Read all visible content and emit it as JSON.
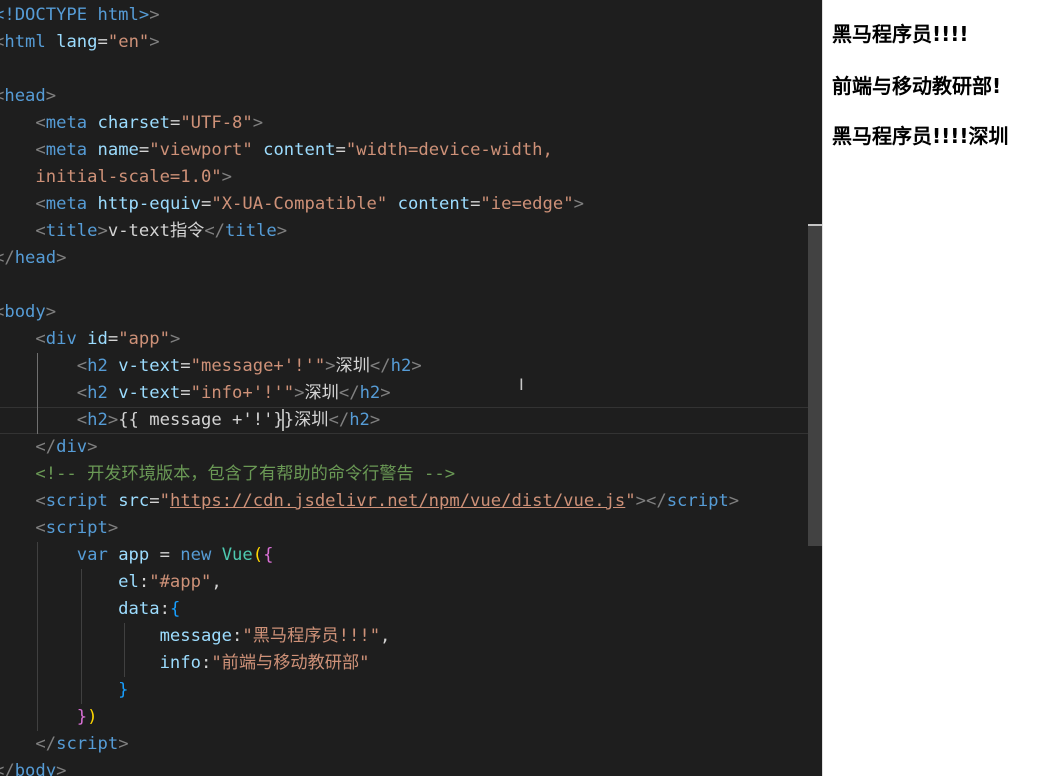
{
  "editor": {
    "lines": [
      [
        {
          "t": "<!DOCTYPE html>",
          "c": "#569cd6"
        },
        {
          "t": ">",
          "c": "#808080"
        }
      ],
      [
        {
          "t": "<",
          "c": "#808080"
        },
        {
          "t": "html",
          "c": "#569cd6"
        },
        {
          "t": " lang",
          "c": "#9cdcfe"
        },
        {
          "t": "=",
          "c": "#d4d4d4"
        },
        {
          "t": "\"en\"",
          "c": "#ce9178"
        },
        {
          "t": ">",
          "c": "#808080"
        }
      ],
      [],
      [
        {
          "t": "<",
          "c": "#808080"
        },
        {
          "t": "head",
          "c": "#569cd6"
        },
        {
          "t": ">",
          "c": "#808080"
        }
      ],
      [
        {
          "t": "    <",
          "c": "#808080"
        },
        {
          "t": "meta",
          "c": "#569cd6"
        },
        {
          "t": " charset",
          "c": "#9cdcfe"
        },
        {
          "t": "=",
          "c": "#d4d4d4"
        },
        {
          "t": "\"UTF-8\"",
          "c": "#ce9178"
        },
        {
          "t": ">",
          "c": "#808080"
        }
      ],
      [
        {
          "t": "    <",
          "c": "#808080"
        },
        {
          "t": "meta",
          "c": "#569cd6"
        },
        {
          "t": " name",
          "c": "#9cdcfe"
        },
        {
          "t": "=",
          "c": "#d4d4d4"
        },
        {
          "t": "\"viewport\"",
          "c": "#ce9178"
        },
        {
          "t": " content",
          "c": "#9cdcfe"
        },
        {
          "t": "=",
          "c": "#d4d4d4"
        },
        {
          "t": "\"width=device-width,",
          "c": "#ce9178"
        }
      ],
      [
        {
          "t": "    initial-scale=1.0\"",
          "c": "#ce9178"
        },
        {
          "t": ">",
          "c": "#808080"
        }
      ],
      [
        {
          "t": "    <",
          "c": "#808080"
        },
        {
          "t": "meta",
          "c": "#569cd6"
        },
        {
          "t": " http-equiv",
          "c": "#9cdcfe"
        },
        {
          "t": "=",
          "c": "#d4d4d4"
        },
        {
          "t": "\"X-UA-Compatible\"",
          "c": "#ce9178"
        },
        {
          "t": " content",
          "c": "#9cdcfe"
        },
        {
          "t": "=",
          "c": "#d4d4d4"
        },
        {
          "t": "\"ie=edge\"",
          "c": "#ce9178"
        },
        {
          "t": ">",
          "c": "#808080"
        }
      ],
      [
        {
          "t": "    <",
          "c": "#808080"
        },
        {
          "t": "title",
          "c": "#569cd6"
        },
        {
          "t": ">",
          "c": "#808080"
        },
        {
          "t": "v-text指令",
          "c": "#d4d4d4"
        },
        {
          "t": "</",
          "c": "#808080"
        },
        {
          "t": "title",
          "c": "#569cd6"
        },
        {
          "t": ">",
          "c": "#808080"
        }
      ],
      [
        {
          "t": "</",
          "c": "#808080"
        },
        {
          "t": "head",
          "c": "#569cd6"
        },
        {
          "t": ">",
          "c": "#808080"
        }
      ],
      [],
      [
        {
          "t": "<",
          "c": "#808080"
        },
        {
          "t": "body",
          "c": "#569cd6"
        },
        {
          "t": ">",
          "c": "#808080"
        }
      ],
      [
        {
          "t": "    <",
          "c": "#808080"
        },
        {
          "t": "div",
          "c": "#569cd6"
        },
        {
          "t": " id",
          "c": "#9cdcfe"
        },
        {
          "t": "=",
          "c": "#d4d4d4"
        },
        {
          "t": "\"app\"",
          "c": "#ce9178"
        },
        {
          "t": ">",
          "c": "#808080"
        }
      ],
      [
        {
          "t": "        <",
          "c": "#808080"
        },
        {
          "t": "h2",
          "c": "#569cd6"
        },
        {
          "t": " v-text",
          "c": "#9cdcfe"
        },
        {
          "t": "=",
          "c": "#d4d4d4"
        },
        {
          "t": "\"message+'!'\"",
          "c": "#ce9178"
        },
        {
          "t": ">",
          "c": "#808080"
        },
        {
          "t": "深圳",
          "c": "#d4d4d4"
        },
        {
          "t": "</",
          "c": "#808080"
        },
        {
          "t": "h2",
          "c": "#569cd6"
        },
        {
          "t": ">",
          "c": "#808080"
        }
      ],
      [
        {
          "t": "        <",
          "c": "#808080"
        },
        {
          "t": "h2",
          "c": "#569cd6"
        },
        {
          "t": " v-text",
          "c": "#9cdcfe"
        },
        {
          "t": "=",
          "c": "#d4d4d4"
        },
        {
          "t": "\"info+'!'\"",
          "c": "#ce9178"
        },
        {
          "t": ">",
          "c": "#808080"
        },
        {
          "t": "深圳",
          "c": "#d4d4d4"
        },
        {
          "t": "</",
          "c": "#808080"
        },
        {
          "t": "h2",
          "c": "#569cd6"
        },
        {
          "t": ">",
          "c": "#808080"
        }
      ],
      [
        {
          "t": "        <",
          "c": "#808080"
        },
        {
          "t": "h2",
          "c": "#569cd6"
        },
        {
          "t": ">",
          "c": "#808080"
        },
        {
          "t": "{{ message +'!'}}深圳",
          "c": "#d4d4d4"
        },
        {
          "t": "</",
          "c": "#808080"
        },
        {
          "t": "h2",
          "c": "#569cd6"
        },
        {
          "t": ">",
          "c": "#808080"
        }
      ],
      [
        {
          "t": "    </",
          "c": "#808080"
        },
        {
          "t": "div",
          "c": "#569cd6"
        },
        {
          "t": ">",
          "c": "#808080"
        }
      ],
      [
        {
          "t": "    <!-- 开发环境版本，包含了有帮助的命令行警告 -->",
          "c": "#6a9955"
        }
      ],
      [
        {
          "t": "    <",
          "c": "#808080"
        },
        {
          "t": "script",
          "c": "#569cd6"
        },
        {
          "t": " src",
          "c": "#9cdcfe"
        },
        {
          "t": "=",
          "c": "#d4d4d4"
        },
        {
          "t": "\"",
          "c": "#ce9178"
        },
        {
          "t": "https://cdn.jsdelivr.net/npm/vue/dist/vue.js",
          "c": "#ce9178",
          "u": true
        },
        {
          "t": "\"",
          "c": "#ce9178"
        },
        {
          "t": "></",
          "c": "#808080"
        },
        {
          "t": "script",
          "c": "#569cd6"
        },
        {
          "t": ">",
          "c": "#808080"
        }
      ],
      [
        {
          "t": "    <",
          "c": "#808080"
        },
        {
          "t": "script",
          "c": "#569cd6"
        },
        {
          "t": ">",
          "c": "#808080"
        }
      ],
      [
        {
          "t": "        ",
          "c": "#d4d4d4"
        },
        {
          "t": "var",
          "c": "#569cd6"
        },
        {
          "t": " app ",
          "c": "#9cdcfe"
        },
        {
          "t": "= ",
          "c": "#d4d4d4"
        },
        {
          "t": "new",
          "c": "#569cd6"
        },
        {
          "t": " Vue",
          "c": "#4ec9b0"
        },
        {
          "t": "(",
          "c": "#ffd700"
        },
        {
          "t": "{",
          "c": "#da70d6"
        }
      ],
      [
        {
          "t": "            el",
          "c": "#9cdcfe"
        },
        {
          "t": ":",
          "c": "#d4d4d4"
        },
        {
          "t": "\"#app\"",
          "c": "#ce9178"
        },
        {
          "t": ",",
          "c": "#d4d4d4"
        }
      ],
      [
        {
          "t": "            data",
          "c": "#9cdcfe"
        },
        {
          "t": ":",
          "c": "#d4d4d4"
        },
        {
          "t": "{",
          "c": "#179fff"
        }
      ],
      [
        {
          "t": "                message",
          "c": "#9cdcfe"
        },
        {
          "t": ":",
          "c": "#d4d4d4"
        },
        {
          "t": "\"黑马程序员!!!\"",
          "c": "#ce9178"
        },
        {
          "t": ",",
          "c": "#d4d4d4"
        }
      ],
      [
        {
          "t": "                info",
          "c": "#9cdcfe"
        },
        {
          "t": ":",
          "c": "#d4d4d4"
        },
        {
          "t": "\"前端与移动教研部\"",
          "c": "#ce9178"
        }
      ],
      [
        {
          "t": "            }",
          "c": "#179fff"
        }
      ],
      [
        {
          "t": "        }",
          "c": "#da70d6"
        },
        {
          "t": ")",
          "c": "#ffd700"
        }
      ],
      [
        {
          "t": "    </",
          "c": "#808080"
        },
        {
          "t": "script",
          "c": "#569cd6"
        },
        {
          "t": ">",
          "c": "#808080"
        }
      ],
      [
        {
          "t": "</",
          "c": "#808080"
        },
        {
          "t": "body",
          "c": "#569cd6"
        },
        {
          "t": ">",
          "c": "#808080"
        }
      ]
    ]
  },
  "preview": {
    "headings": [
      "黑马程序员!!!!",
      "前端与移动教研部!",
      "黑马程序员!!!!深圳"
    ]
  }
}
